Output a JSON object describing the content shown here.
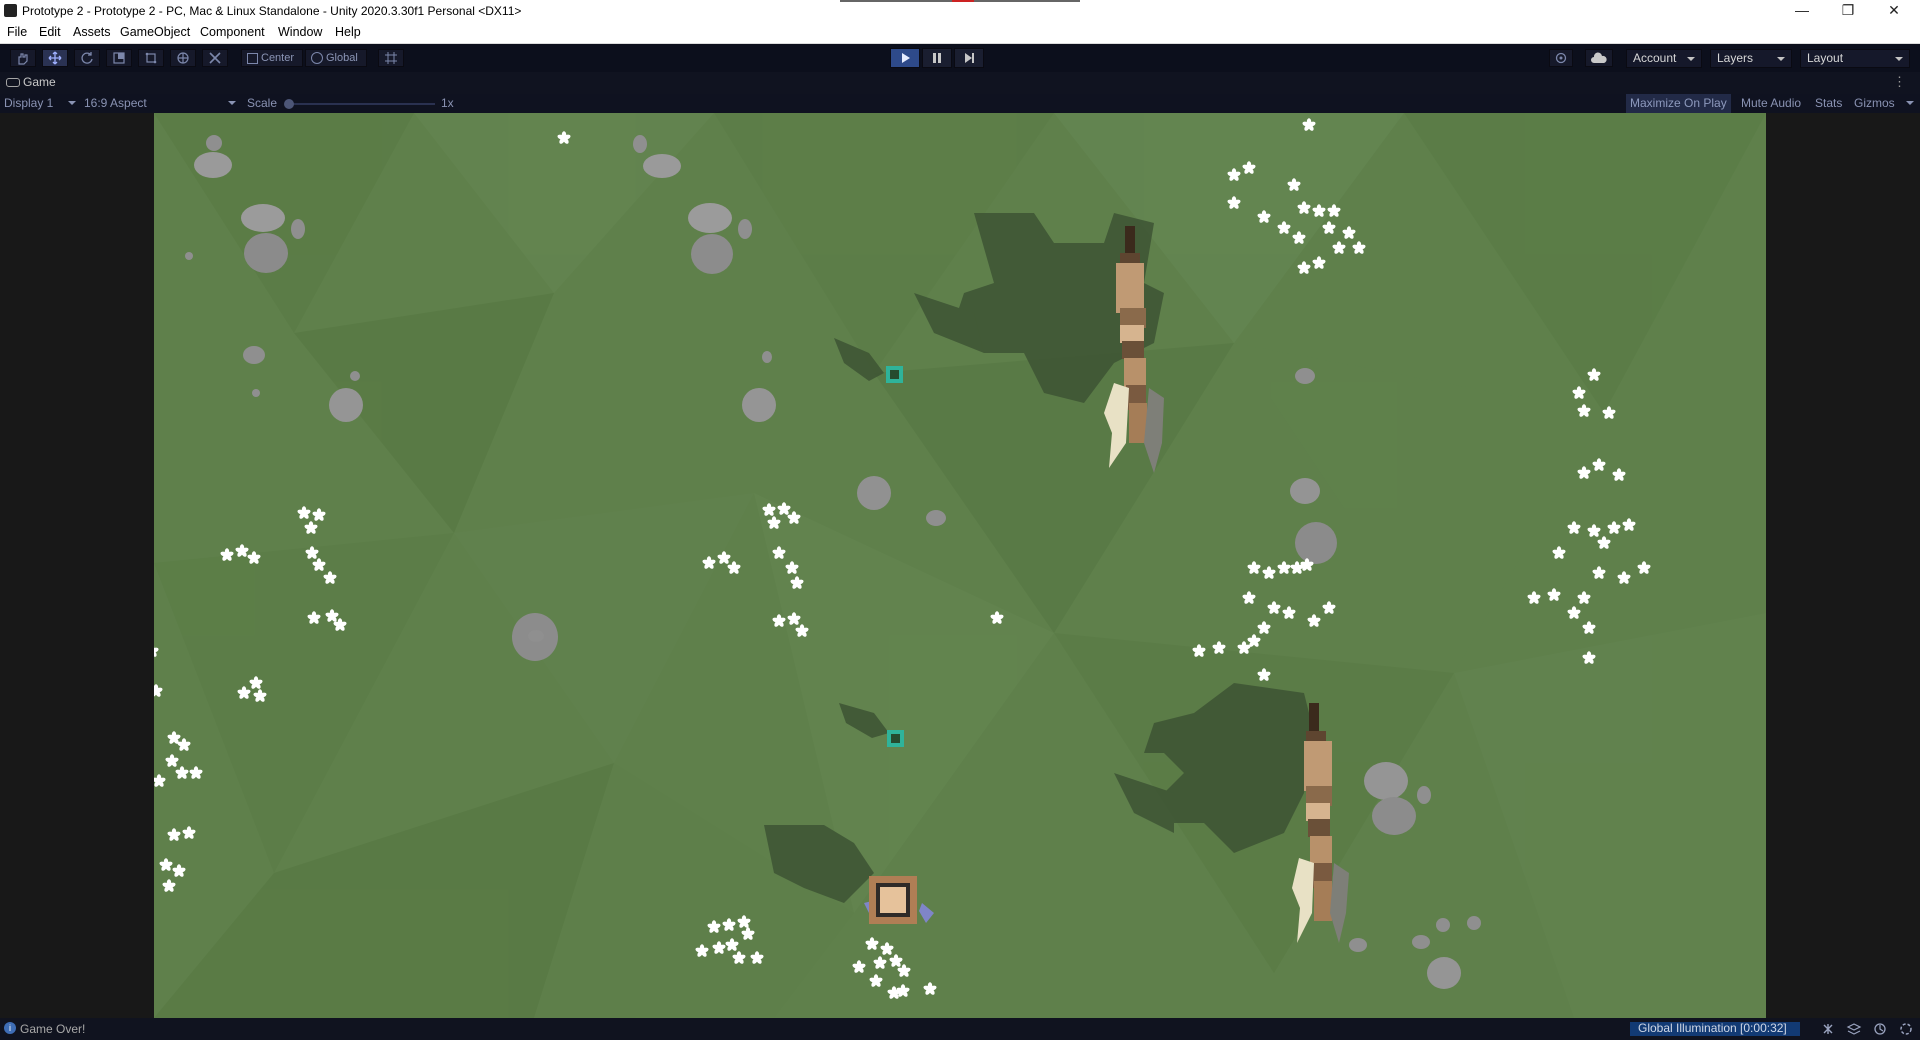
{
  "window": {
    "title": "Prototype 2 - Prototype 2 - PC, Mac & Linux Standalone - Unity 2020.3.30f1 Personal <DX11>",
    "minimize_glyph": "—",
    "restore_glyph": "❐",
    "close_glyph": "✕"
  },
  "menu": {
    "items": [
      "File",
      "Edit",
      "Assets",
      "GameObject",
      "Component",
      "Window",
      "Help"
    ]
  },
  "toolbar": {
    "center_label": "Center",
    "global_label": "Global",
    "account_label": "Account",
    "layers_label": "Layers",
    "layout_label": "Layout",
    "play_active": true
  },
  "game_tab": {
    "label": "Game",
    "display": "Display 1",
    "aspect": "16:9 Aspect",
    "scale_label": "Scale",
    "scale_value": "1x",
    "maximize_on_play": "Maximize On Play",
    "mute_audio": "Mute Audio",
    "stats": "Stats",
    "gizmos": "Gizmos"
  },
  "status": {
    "message": "Game Over!",
    "global_illumination": "Global Illumination [0:00:32]"
  },
  "colors": {
    "grass": "#5d7e4a",
    "grass_dark": "#527341",
    "accent_blue": "#2e4a8a",
    "pickup_teal": "#2fb39a"
  }
}
